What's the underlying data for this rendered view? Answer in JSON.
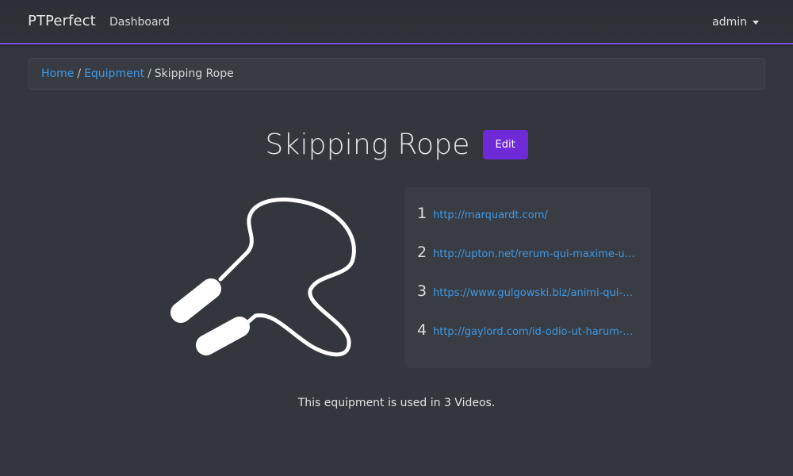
{
  "navbar": {
    "brand": "PTPerfect",
    "links": [
      "Dashboard"
    ],
    "user": "admin"
  },
  "breadcrumb": {
    "items": [
      "Home",
      "Equipment"
    ],
    "current": "Skipping Rope"
  },
  "equipment": {
    "title": "Skipping Rope",
    "edit_label": "Edit",
    "image_icon": "skipping-rope-icon",
    "links": [
      {
        "num": "1",
        "url": "http://marquardt.com/"
      },
      {
        "num": "2",
        "url": "http://upton.net/rerum-qui-maxime-unde-voluptas"
      },
      {
        "num": "3",
        "url": "https://www.gulgowski.biz/animi-qui-sed-voluptatem"
      },
      {
        "num": "4",
        "url": "http://gaylord.com/id-odio-ut-harum-voluptatem"
      }
    ],
    "usage_text": "This equipment is used in 3 Videos."
  },
  "colors": {
    "background": "#33363d",
    "accent": "#6f2ad8",
    "link": "#3d9ae8"
  }
}
